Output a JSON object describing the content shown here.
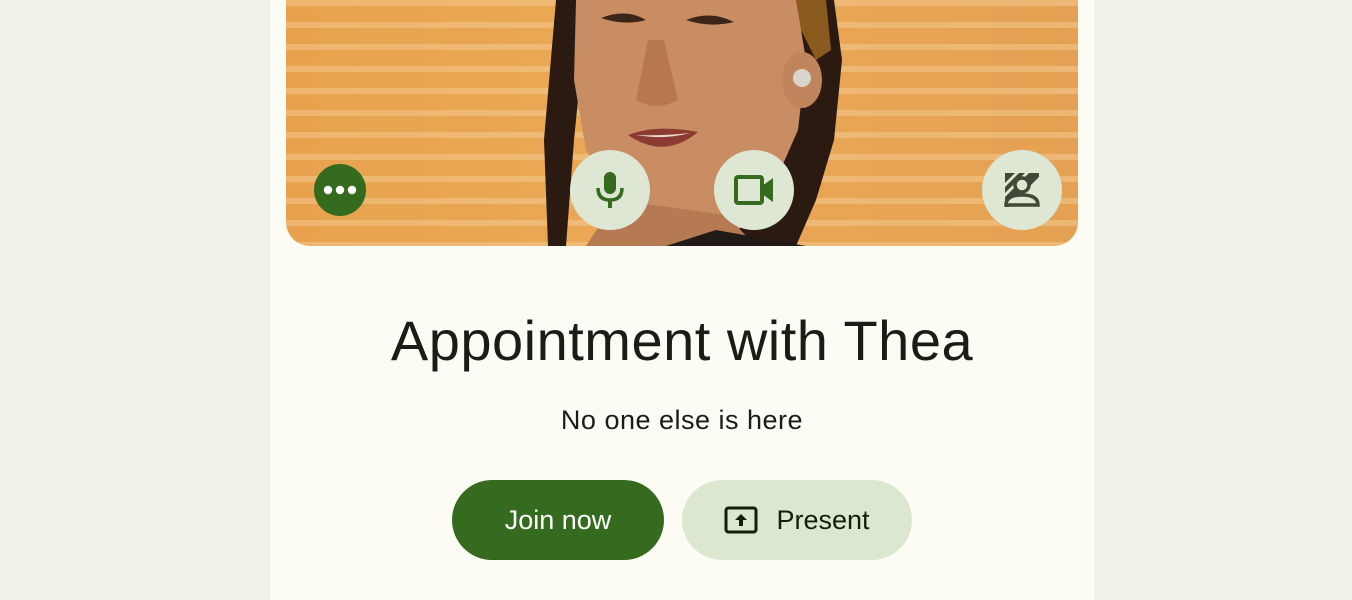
{
  "meeting": {
    "title": "Appointment with Thea",
    "status": "No one else is here"
  },
  "preview": {
    "controls": [
      {
        "name": "more-options",
        "icon": "more-horiz-icon"
      },
      {
        "name": "microphone",
        "icon": "mic-icon"
      },
      {
        "name": "camera",
        "icon": "videocam-icon"
      },
      {
        "name": "background-effects",
        "icon": "background-blur-icon"
      }
    ]
  },
  "actions": {
    "join_label": "Join now",
    "present_label": "Present"
  },
  "colors": {
    "primary": "#346b1f",
    "tonal": "#dbe8cf",
    "control_bg": "#dee6d4",
    "surface": "#fcfcf5",
    "background": "#f1f3ea"
  }
}
